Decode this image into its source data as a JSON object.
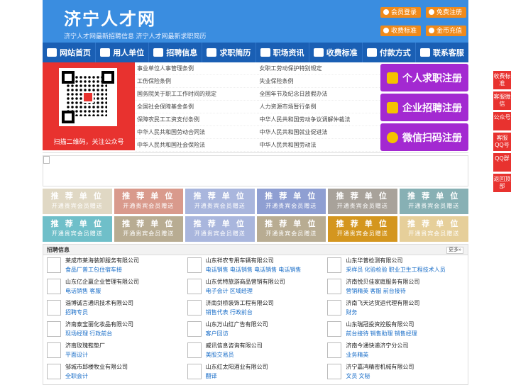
{
  "header": {
    "logo": "济宁人才网",
    "slogan": "济宁人才网最新招聘信息   济宁人才网最新求职简历",
    "buttons": [
      "会员登录",
      "免费注册",
      "收费标准",
      "金币充值"
    ]
  },
  "nav": [
    "网站首页",
    "用人单位",
    "招聘信息",
    "求职简历",
    "职场资讯",
    "收费标准",
    "付款方式",
    "联系客服"
  ],
  "qr": {
    "caption": "扫描二维码，关注公众号"
  },
  "laws": [
    "事业单位人事管理条例",
    "女职工劳动保护特别规定",
    "工伤保险条例",
    "失业保险条例",
    "国务院关于职工工作时间的规定",
    "全国年节及纪念日放假办法",
    "全国社会保障基金条例",
    "人力资源市场暂行条例",
    "保障农民工工资支付条例",
    "中华人民共和国劳动争议调解仲裁法",
    "中华人民共和国劳动合同法",
    "中华人民共和国就业促进法",
    "中华人民共和国社会保险法",
    "中华人民共和国劳动法"
  ],
  "register": [
    "个人求职注册",
    "企业招聘注册",
    "微信扫码注册"
  ],
  "tiles": {
    "title": "推 荐 单 位",
    "sub": "开通贵宾会员赠送",
    "colors": [
      "#e0d8c4",
      "#d99a8c",
      "#a9b6dd",
      "#8f9fd2",
      "#a8a29a",
      "#87b0b4",
      "#6fbfc9",
      "#b8ac92",
      "#a9b6dd",
      "#b8ac92",
      "#d4961e",
      "#e6cf9a"
    ]
  },
  "jobs": {
    "title": "招聘信息",
    "more": "更多»",
    "list": [
      {
        "company": "莱成市莱海装卸服务有限公司",
        "positions": "食品厂普工包住宿车接"
      },
      {
        "company": "山东祥农专用车辆有限公司",
        "positions": "电话销售 电话销售 电话销售 电话销售"
      },
      {
        "company": "山东华普检测有限公司",
        "positions": "采样员 化验检验 职业卫生工程技术人员"
      },
      {
        "company": "山东亿企赢企业管理有限公司",
        "positions": "电话销售 客服"
      },
      {
        "company": "山东优特旅游商品营销有限公司",
        "positions": "电子会计 区域经理"
      },
      {
        "company": "济南悦贝佳家庭服务有限公司",
        "positions": "营销精英 客服 前台接待"
      },
      {
        "company": "淄博诚言通讯技术有限公司",
        "positions": "招聘专员"
      },
      {
        "company": "济南剑桥装饰工程有限公司",
        "positions": "销售代表 行政前台"
      },
      {
        "company": "济南飞天达货运代理有限公司",
        "positions": "财务"
      },
      {
        "company": "济南泰宝丽化妆品有限公司",
        "positions": "现场经理 行政前台"
      },
      {
        "company": "山东万山红广告有限公司",
        "positions": "客户回访"
      },
      {
        "company": "山东瑞冠投资控股有限公司",
        "positions": "前台接待 销售助理 销售经理"
      },
      {
        "company": "济南玫瑰鞋垫厂",
        "positions": "平面设计"
      },
      {
        "company": "威讯信息咨询有限公司",
        "positions": "美股交易员"
      },
      {
        "company": "济南今通快递济宁分公司",
        "positions": "业务精英"
      },
      {
        "company": "邹城市邱楼牧业有限公司",
        "positions": "全职会计"
      },
      {
        "company": "山东红太阳酒业有限公司",
        "positions": "翻译"
      },
      {
        "company": "济宁嘉鸿精密机械有限公司",
        "positions": "文员   文秘"
      }
    ]
  },
  "side": [
    "收费标准",
    "客服微信",
    "公众号",
    "客服QQ号",
    "QQ群",
    "返回顶部"
  ],
  "colors": {
    "header": "#3a8de0",
    "nav": "#1a5fb4",
    "register": "#a329d1",
    "accent": "#f08a1a",
    "side": "#e8322f"
  }
}
